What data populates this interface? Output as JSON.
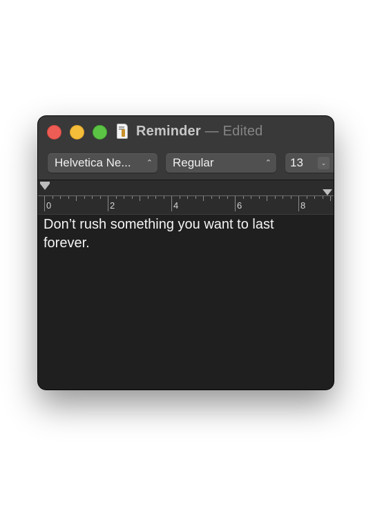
{
  "window": {
    "title": "Reminder",
    "separator": "—",
    "status": "Edited"
  },
  "toolbar": {
    "font_family": "Helvetica Ne...",
    "font_style": "Regular",
    "font_size": "13"
  },
  "ruler": {
    "labels": [
      "0",
      "2",
      "4",
      "6",
      "8"
    ]
  },
  "document": {
    "text": "Don’t rush something you want to last forever."
  },
  "colors": {
    "close": "#ee5d55",
    "minimize": "#f4bd3a",
    "zoom": "#5cc445"
  },
  "icons": {
    "document": "document-icon",
    "popup": "chevron-updown-icon",
    "stepper": "chevron-down-icon"
  }
}
